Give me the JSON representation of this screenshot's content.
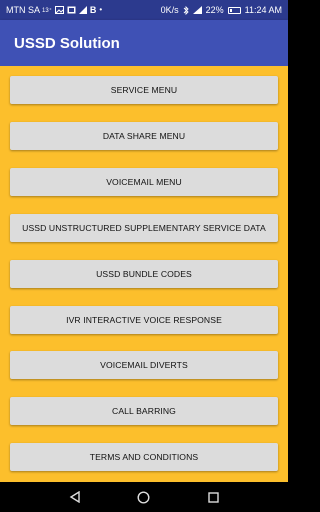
{
  "status_bar": {
    "carrier": "MTN SA",
    "network_badge": "13⁺",
    "speed": "0K/s",
    "battery_percent": "22%",
    "time": "11:24 AM",
    "icons": [
      "image-icon",
      "gallery-icon",
      "bluetooth-b-icon",
      "bluetooth-icon",
      "signal-icon",
      "battery-icon"
    ]
  },
  "app": {
    "title": "USSD Solution"
  },
  "menu": {
    "items": [
      {
        "label": "SERVICE MENU"
      },
      {
        "label": "DATA SHARE MENU"
      },
      {
        "label": "VOICEMAIL MENU"
      },
      {
        "label": "USSD UNSTRUCTURED SUPPLEMENTARY SERVICE DATA"
      },
      {
        "label": "USSD BUNDLE CODES"
      },
      {
        "label": "IVR INTERACTIVE VOICE RESPONSE"
      },
      {
        "label": "VOICEMAIL DIVERTS"
      },
      {
        "label": "CALL BARRING"
      },
      {
        "label": "TERMS AND CONDITIONS"
      }
    ]
  },
  "colors": {
    "status_bar": "#2c3a8e",
    "app_bar": "#3f51b5",
    "background": "#fcbf2c",
    "button": "#dcdcdc"
  },
  "nav_bar": {
    "icons": [
      "back-triangle-icon",
      "home-circle-icon",
      "recents-square-icon"
    ]
  }
}
